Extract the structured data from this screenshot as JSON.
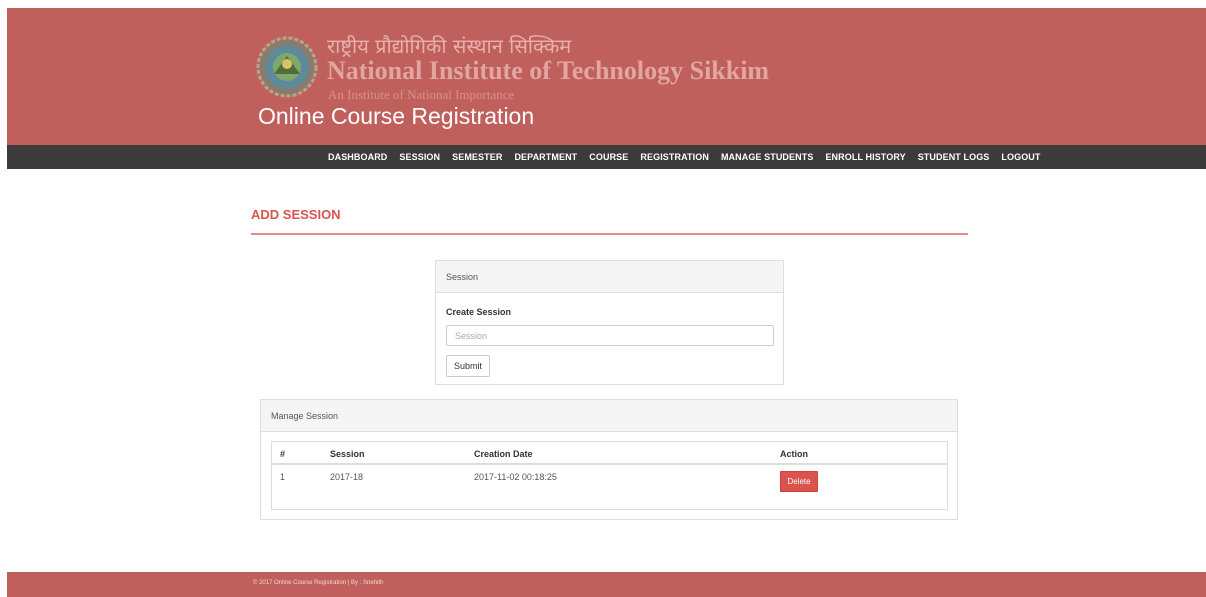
{
  "header": {
    "institute_hindi": "राष्ट्रीय प्रौद्योगिकी संस्थान सिक्किम",
    "institute_name": "National Institute of Technology Sikkim",
    "institute_subtitle": "An Institute of National Importance",
    "app_title": "Online Course Registration",
    "logo_icon": "institute-emblem-icon",
    "colors": {
      "banner": "#c0605d",
      "navbar": "#3b3b3b"
    }
  },
  "nav": {
    "items": [
      "DASHBOARD",
      "SESSION",
      "SEMESTER",
      "DEPARTMENT",
      "COURSE",
      "REGISTRATION",
      "MANAGE STUDENTS",
      "ENROLL HISTORY",
      "STUDENT LOGS",
      "LOGOUT"
    ]
  },
  "page": {
    "heading": "ADD SESSION",
    "accent_color": "#d9534f"
  },
  "session_form": {
    "panel_title": "Session",
    "field_label": "Create Session",
    "input_value": "",
    "input_placeholder": "Session",
    "submit_label": "Submit"
  },
  "manage_session": {
    "panel_title": "Manage Session",
    "columns": [
      "#",
      "Session",
      "Creation Date",
      "Action"
    ],
    "rows": [
      {
        "index": "1",
        "session": "2017-18",
        "creation_date": "2017-11-02 00:18:25",
        "action_label": "Delete"
      }
    ]
  },
  "footer": {
    "text": "© 2017 Online Course Registration | By : Snehith"
  }
}
